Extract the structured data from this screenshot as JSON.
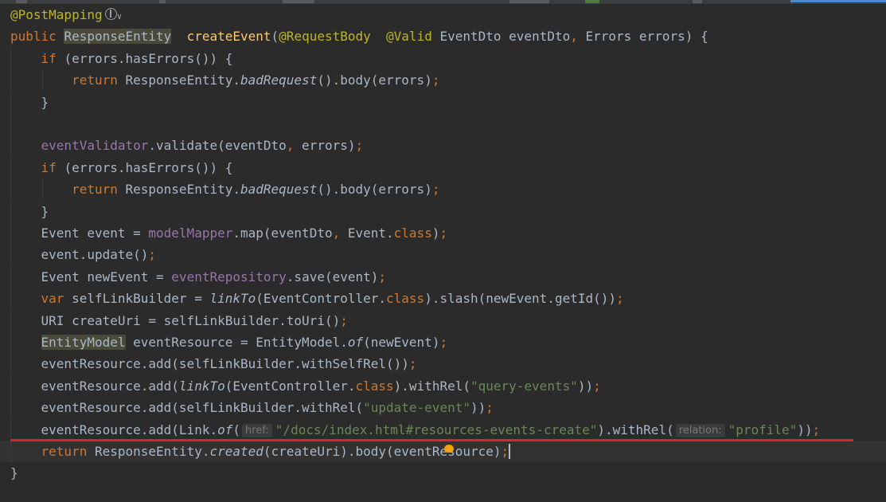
{
  "editor": {
    "lines": [
      {
        "segs": [
          [
            "ann",
            "@PostMapping"
          ]
        ],
        "icon": true
      },
      {
        "segs": [
          [
            "kw",
            "public "
          ],
          [
            "hl",
            "ResponseEntity"
          ],
          [
            "",
            "  "
          ],
          [
            "fn",
            "createEvent"
          ],
          [
            "",
            "("
          ],
          [
            "ann",
            "@RequestBody"
          ],
          [
            "",
            "  "
          ],
          [
            "ann",
            "@Valid "
          ],
          [
            "",
            "EventDto eventDto"
          ],
          [
            "kw",
            ", "
          ],
          [
            "",
            "Errors errors) {"
          ]
        ]
      },
      {
        "segs": [
          [
            "",
            "    "
          ],
          [
            "kw",
            "if "
          ],
          [
            "",
            "(errors.hasErrors()) {"
          ]
        ]
      },
      {
        "segs": [
          [
            "",
            "        "
          ],
          [
            "kw",
            "return "
          ],
          [
            "",
            "ResponseEntity."
          ],
          [
            "it",
            "badRequest"
          ],
          [
            "",
            "().body(errors)"
          ],
          [
            "kw",
            ";"
          ]
        ]
      },
      {
        "segs": [
          [
            "",
            "    }"
          ]
        ]
      },
      {
        "segs": []
      },
      {
        "segs": [
          [
            "",
            "    "
          ],
          [
            "fld",
            "eventValidator"
          ],
          [
            "",
            ".validate(eventDto"
          ],
          [
            "kw",
            ", "
          ],
          [
            "",
            "errors)"
          ],
          [
            "kw",
            ";"
          ]
        ]
      },
      {
        "segs": [
          [
            "",
            "    "
          ],
          [
            "kw",
            "if "
          ],
          [
            "",
            "(errors.hasErrors()) {"
          ]
        ]
      },
      {
        "segs": [
          [
            "",
            "        "
          ],
          [
            "kw",
            "return "
          ],
          [
            "",
            "ResponseEntity."
          ],
          [
            "it",
            "badRequest"
          ],
          [
            "",
            "().body(errors)"
          ],
          [
            "kw",
            ";"
          ]
        ]
      },
      {
        "segs": [
          [
            "",
            "    }"
          ]
        ]
      },
      {
        "segs": [
          [
            "",
            "    Event event = "
          ],
          [
            "fld",
            "modelMapper"
          ],
          [
            "",
            ".map(eventDto"
          ],
          [
            "kw",
            ", "
          ],
          [
            "",
            "Event."
          ],
          [
            "kw",
            "class"
          ],
          [
            "",
            ")"
          ],
          [
            "kw",
            ";"
          ]
        ]
      },
      {
        "segs": [
          [
            "",
            "    event.update()"
          ],
          [
            "kw",
            ";"
          ]
        ]
      },
      {
        "segs": [
          [
            "",
            "    Event newEvent = "
          ],
          [
            "fld",
            "eventRepository"
          ],
          [
            "",
            ".save(event)"
          ],
          [
            "kw",
            ";"
          ]
        ]
      },
      {
        "segs": [
          [
            "",
            "    "
          ],
          [
            "kw",
            "var "
          ],
          [
            "",
            "selfLinkBuilder = "
          ],
          [
            "it",
            "linkTo"
          ],
          [
            "",
            "(EventController."
          ],
          [
            "kw",
            "class"
          ],
          [
            "",
            ").slash(newEvent.getId())"
          ],
          [
            "kw",
            ";"
          ]
        ]
      },
      {
        "segs": [
          [
            "",
            "    URI createUri = selfLinkBuilder.toUri()"
          ],
          [
            "kw",
            ";"
          ]
        ]
      },
      {
        "segs": [
          [
            "",
            "    "
          ],
          [
            "hl",
            "EntityModel"
          ],
          [
            "",
            " eventResource = EntityModel."
          ],
          [
            "it",
            "of"
          ],
          [
            "",
            "(newEvent)"
          ],
          [
            "kw",
            ";"
          ]
        ]
      },
      {
        "segs": [
          [
            "",
            "    eventResource.add(selfLinkBuilder.withSelfRel())"
          ],
          [
            "kw",
            ";"
          ]
        ]
      },
      {
        "segs": [
          [
            "",
            "    eventResource.add("
          ],
          [
            "it",
            "linkTo"
          ],
          [
            "",
            "(EventController."
          ],
          [
            "kw",
            "class"
          ],
          [
            "",
            ").withRel("
          ],
          [
            "str",
            "\"query-events\""
          ],
          [
            "",
            "))"
          ],
          [
            "kw",
            ";"
          ]
        ]
      },
      {
        "segs": [
          [
            "",
            "    eventResource.add(selfLinkBuilder.withRel("
          ],
          [
            "str",
            "\"update-event\""
          ],
          [
            "",
            "))"
          ],
          [
            "kw",
            ";"
          ]
        ]
      },
      {
        "segs": [
          [
            "",
            "    eventResource.add(Link."
          ],
          [
            "it",
            "of"
          ],
          [
            "",
            "("
          ],
          [
            "hint",
            "href:"
          ],
          [
            "str",
            "\"/docs/index.html#resources-events-create\""
          ],
          [
            "",
            ").withRel("
          ],
          [
            "hint",
            "relation:"
          ],
          [
            "str",
            "\"profile\""
          ],
          [
            "",
            "))"
          ],
          [
            "kw",
            ";"
          ]
        ]
      },
      {
        "segs": [
          [
            "",
            "    "
          ],
          [
            "kw",
            "return "
          ],
          [
            "",
            "ResponseEntity."
          ],
          [
            "it",
            "created"
          ],
          [
            "",
            "(createUri).body(eventResource)"
          ],
          [
            "kw",
            ";"
          ],
          [
            "caret",
            ""
          ]
        ],
        "current": true
      },
      {
        "segs": [
          [
            "",
            "}"
          ]
        ]
      }
    ]
  }
}
